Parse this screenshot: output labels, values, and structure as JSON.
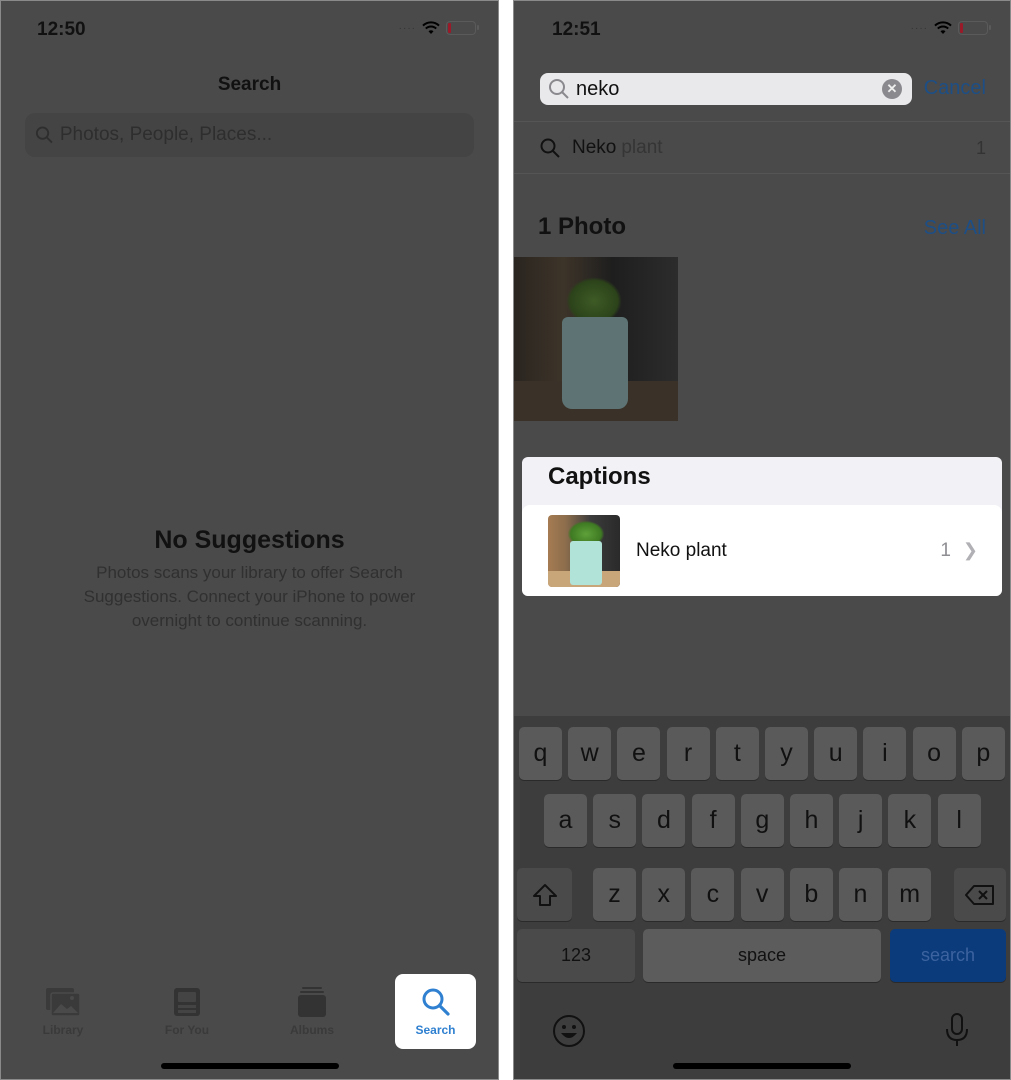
{
  "left_screen": {
    "status": {
      "time": "12:50"
    },
    "title": "Search",
    "search": {
      "placeholder": "Photos, People, Places..."
    },
    "empty_state": {
      "title": "No Suggestions",
      "body": "Photos scans your library to offer Search Suggestions. Connect your iPhone to power overnight to continue scanning."
    },
    "tabs": [
      {
        "label": "Library",
        "icon": "photo-library-icon",
        "active": false
      },
      {
        "label": "For You",
        "icon": "for-you-icon",
        "active": false
      },
      {
        "label": "Albums",
        "icon": "albums-icon",
        "active": false
      },
      {
        "label": "Search",
        "icon": "search-icon",
        "active": true
      }
    ]
  },
  "right_screen": {
    "status": {
      "time": "12:51"
    },
    "search": {
      "value": "neko",
      "cancel_label": "Cancel"
    },
    "suggestion": {
      "match": "Neko",
      "rest": "plant",
      "count": "1"
    },
    "photos_section": {
      "title": "1 Photo",
      "see_all_label": "See All"
    },
    "captions_section": {
      "title": "Captions",
      "items": [
        {
          "label": "Neko plant",
          "count": "1"
        }
      ]
    },
    "keyboard": {
      "row1": [
        "q",
        "w",
        "e",
        "r",
        "t",
        "y",
        "u",
        "i",
        "o",
        "p"
      ],
      "row2": [
        "a",
        "s",
        "d",
        "f",
        "g",
        "h",
        "j",
        "k",
        "l"
      ],
      "row3": [
        "z",
        "x",
        "c",
        "v",
        "b",
        "n",
        "m"
      ],
      "numbers_label": "123",
      "space_label": "space",
      "search_label": "search"
    }
  },
  "colors": {
    "accent_blue": "#2f80d0",
    "dim_link_blue": "#1d4f86",
    "overlay_gray": "#4a4a4a",
    "battery_low": "#9b1a2a"
  }
}
